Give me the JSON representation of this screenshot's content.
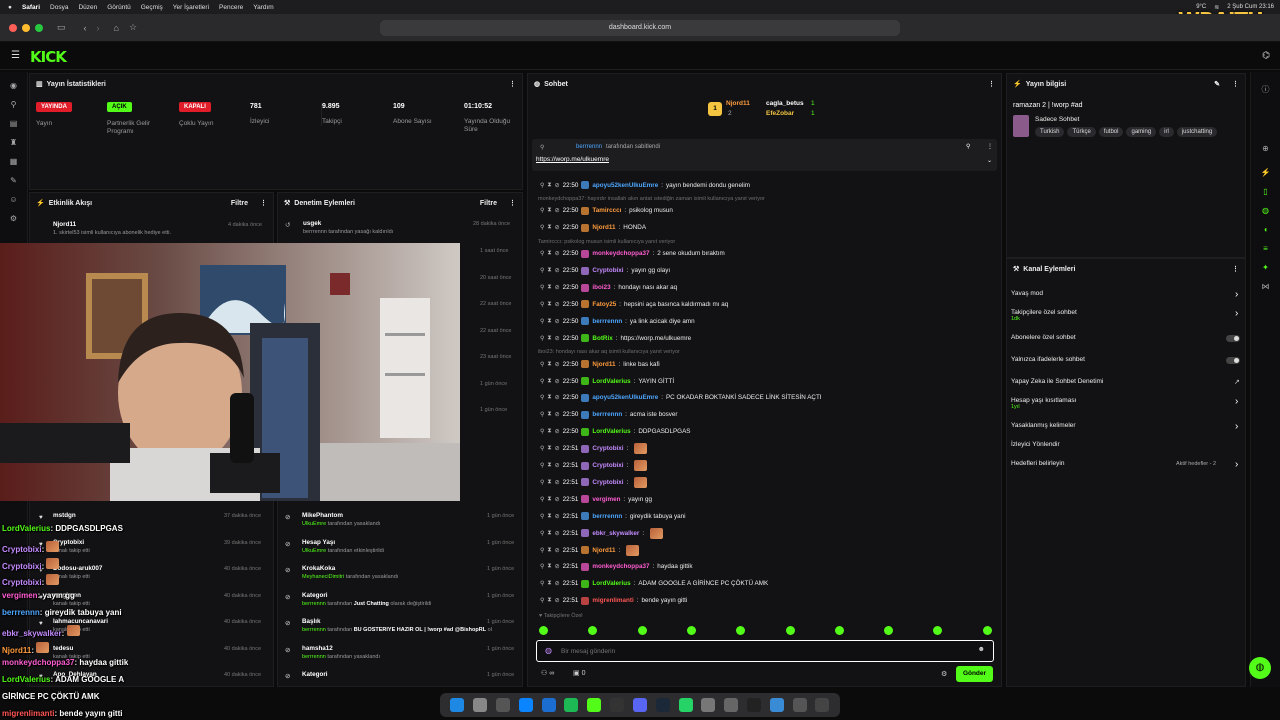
{
  "menubar": {
    "app": "Safari",
    "items": [
      "Dosya",
      "Düzen",
      "Görüntü",
      "Geçmiş",
      "Yer İşaretleri",
      "Pencere",
      "Yardım"
    ],
    "weather": "9°C",
    "clock": "2 Şub Cum 23:16"
  },
  "browser": {
    "url": "dashboard.kick.com"
  },
  "overlay_logo": "WRAITH",
  "brand": {
    "logo": "KICK",
    "accent": "#53fc18"
  },
  "stats": {
    "title": "Yayın İstatistikleri",
    "live_badge": "YAYINDA",
    "live_label": "Yayın",
    "partner_badge": "AÇIK",
    "partner_label": "Partnerlik Gelir Programı",
    "multi_badge": "KAPALI",
    "multi_label": "Çoklu Yayın",
    "viewers": "781",
    "viewers_label": "İzleyici",
    "followers": "9.895",
    "followers_label": "Takipçi",
    "subs": "109",
    "subs_label": "Abone Sayısı",
    "duration": "01:10:52",
    "duration_label": "Yayında Olduğu Süre"
  },
  "activity": {
    "title": "Etkinlik Akışı",
    "filter": "Filtre",
    "first": {
      "name": "Njord11",
      "desc": "1. skirtel53 isimli kullanıcıya abonelik hediye etti.",
      "time": "4 dakika önce"
    },
    "items": [
      {
        "name": "mstdgn",
        "desc": "",
        "time": "37 dakika önce"
      },
      {
        "name": "Cryptobixi",
        "desc": "kanalı takip etti",
        "time": "39 dakika önce"
      },
      {
        "name": "Dodosu-aruk007",
        "desc": "kanalı takip etti",
        "time": "40 dakika önce"
      },
      {
        "name": "vergimen",
        "desc": "kanalı takip etti",
        "time": "40 dakika önce"
      },
      {
        "name": "lahmacuncanavari",
        "desc": "kanalı takip etti",
        "time": "40 dakika önce"
      },
      {
        "name": "tedesu",
        "desc": "kanalı takip etti",
        "time": "40 dakika önce"
      },
      {
        "name": "Apo_Dehlayan",
        "desc": "",
        "time": "40 dakika önce"
      }
    ]
  },
  "moderation": {
    "title": "Denetim Eylemleri",
    "filter": "Filtre",
    "first": {
      "name": "usgek",
      "desc": "berrrennn tarafından yasağı kaldırıldı",
      "time": "28 dakika önce"
    },
    "times": [
      "1 saat önce",
      "20 saat önce",
      "22 saat önce",
      "22 saat önce",
      "23 saat önce",
      "1 gün önce",
      "1 gün önce"
    ],
    "items": [
      {
        "name": "MikePhantom",
        "actor": "UlkuEmre",
        "desc": "tarafından yasaklandı",
        "time": "1 gün önce"
      },
      {
        "name": "Hesap Yaşı",
        "actor": "UlkuEmre",
        "desc": "tarafından etkinleştirildi",
        "time": "1 gün önce"
      },
      {
        "name": "KrokaKoka",
        "actor": "MeyhaneciDimitri",
        "desc": "tarafından yasaklandı",
        "time": "1 gün önce"
      },
      {
        "name": "Kategori",
        "actor": "berrrennn",
        "desc": "tarafından",
        "extra": "Just Chatting",
        "desc2": "olarak değiştirildi",
        "time": "1 gün önce"
      },
      {
        "name": "Başlık",
        "actor": "berrrennn",
        "desc": "tarafından",
        "extra": "BU GÖSTERİYE HAZIR OL | !worp #ad @BishopRL",
        "desc2": "olarak değiştirildi",
        "time": "1 gün önce"
      },
      {
        "name": "hamsha12",
        "actor": "berrrennn",
        "desc": "tarafından yasaklandı",
        "time": "1 gün önce"
      },
      {
        "name": "Kategori",
        "actor": "",
        "desc": "",
        "time": "1 gün önce"
      }
    ]
  },
  "chat": {
    "title": "Sohbet",
    "leaders": [
      {
        "rank": "1",
        "name": "Njord11",
        "gift": "cagla_betus",
        "count": "1"
      },
      {
        "rank": "2",
        "name": "",
        "gift": "EfeZobar",
        "count": "1"
      }
    ],
    "pinned": {
      "by": "berrrennn",
      "label": "tarafından sabitlendi",
      "link": "https://worp.me/ulkuemre"
    },
    "messages": [
      {
        "time": "22:50",
        "user": "apoyu52kenUlkuEmre",
        "color": "#4ea7ff",
        "text": "yayın bendemi dondu genelim"
      },
      {
        "reply": "monkeydchoppa37: hayırdır insallah akın antat ıstediğin zaman isimli kullanıcıya yanıt veriyor"
      },
      {
        "time": "22:50",
        "user": "Tamircccı",
        "color": "#ff9c3d",
        "text": "psikolog musun"
      },
      {
        "time": "22:50",
        "user": "Njord11",
        "color": "#ff9c3d",
        "text": "HONDA"
      },
      {
        "reply": "Tamircccı: psikolog musun isimli kullanıcıya yanıt veriyor"
      },
      {
        "time": "22:50",
        "user": "monkeydchoppa37",
        "color": "#ff5ed2",
        "text": "2 sene okudum bıraktım"
      },
      {
        "time": "22:50",
        "user": "Cryptobixi",
        "color": "#c58bff",
        "text": "yayın gg olayı"
      },
      {
        "time": "22:50",
        "user": "iboi23",
        "color": "#ff5ed2",
        "text": "hondayı nası akar aq"
      },
      {
        "time": "22:50",
        "user": "Fatoy25",
        "color": "#ff9c3d",
        "text": "hepsini aça basınca kaldırmadı mı aq"
      },
      {
        "time": "22:50",
        "user": "berrrennn",
        "color": "#4ea7ff",
        "text": "ya link acicak diye amn"
      },
      {
        "time": "22:50",
        "user": "BotRix",
        "color": "#53fc18",
        "text": "https://worp.me/ulkuemre"
      },
      {
        "reply": "iboi23: hondayı nası akar aq isimli kullanıcıya yanıt veriyor"
      },
      {
        "time": "22:50",
        "user": "Njord11",
        "color": "#ff9c3d",
        "text": "linke bas kafi"
      },
      {
        "time": "22:50",
        "user": "LordValerius",
        "color": "#53fc18",
        "text": "YAYIN GİTTİ"
      },
      {
        "time": "22:50",
        "user": "apoyu52kenUlkuEmre",
        "color": "#4ea7ff",
        "text": "PC OKADAR BOKTANKİ SADECE LİNK SİTESİN AÇTI"
      },
      {
        "time": "22:50",
        "user": "berrrennn",
        "color": "#4ea7ff",
        "text": "acma iste bosver"
      },
      {
        "time": "22:50",
        "user": "LordValerius",
        "color": "#53fc18",
        "text": "DDPGASDLPGAS"
      },
      {
        "time": "22:51",
        "user": "Cryptobixi",
        "color": "#c58bff",
        "text": ""
      },
      {
        "time": "22:51",
        "user": "Cryptobixi",
        "color": "#c58bff",
        "text": ""
      },
      {
        "time": "22:51",
        "user": "Cryptobixi",
        "color": "#c58bff",
        "text": ""
      },
      {
        "time": "22:51",
        "user": "vergimen",
        "color": "#ff5ed2",
        "text": "yayın gg"
      },
      {
        "time": "22:51",
        "user": "berrrennn",
        "color": "#4ea7ff",
        "text": "gireydik tabuya yani"
      },
      {
        "time": "22:51",
        "user": "ebkr_skywalker",
        "color": "#c58bff",
        "text": ""
      },
      {
        "time": "22:51",
        "user": "Njord11",
        "color": "#ff9c3d",
        "text": ""
      },
      {
        "time": "22:51",
        "user": "monkeydchoppa37",
        "color": "#ff5ed2",
        "text": "haydaa gittik"
      },
      {
        "time": "22:51",
        "user": "LordValerius",
        "color": "#53fc18",
        "text": "ADAM GOOGLE A GİRİNCE PC ÇÖKTÜ AMK"
      },
      {
        "time": "22:51",
        "user": "migrenlimanti",
        "color": "#ff5555",
        "text": "bende yayın gitti"
      }
    ],
    "followers_only": "Takipçilere Özel",
    "input_placeholder": "Bir mesaj gönderin",
    "count": "0",
    "send": "Gönder"
  },
  "overlay_chat": [
    {
      "user": "LordValerius",
      "color": "#53fc18",
      "text": "DDPGASDLPGAS"
    },
    {
      "user": "Cryptobixi",
      "color": "#c58bff",
      "text": ""
    },
    {
      "user": "Cryptobixi",
      "color": "#c58bff",
      "text": ""
    },
    {
      "user": "Cryptobixi",
      "color": "#c58bff",
      "text": ""
    },
    {
      "user": "vergimen",
      "color": "#ff5ed2",
      "text": "yayın gg"
    },
    {
      "user": "berrrennn",
      "color": "#4ea7ff",
      "text": "gireydik tabuya yani"
    },
    {
      "user": "ebkr_skywalker",
      "color": "#c58bff",
      "text": ""
    },
    {
      "user": "Njord11",
      "color": "#ff9c3d",
      "text": ""
    },
    {
      "user": "monkeydchoppa37",
      "color": "#ff5ed2",
      "text": "haydaa gittik"
    },
    {
      "user": "LordValerius",
      "color": "#53fc18",
      "text": "ADAM GOOGLE A"
    },
    {
      "user": "",
      "color": "#fff",
      "text": "GİRİNCE PC ÇÖKTÜ AMK"
    },
    {
      "user": "migrenlimanti",
      "color": "#ff5555",
      "text": "bende yayın gitti"
    }
  ],
  "stream_info": {
    "title": "Yayın bilgisi",
    "stream_title": "ramazan 2 | !worp #ad",
    "category": "Sadece Sohbet",
    "tags": [
      "Turkish",
      "Türkçe",
      "futbol",
      "gaming",
      "irl",
      "justchatting"
    ]
  },
  "channel_actions": {
    "title": "Kanal Eylemleri",
    "items": [
      {
        "label": "Yavaş mod",
        "sub": "",
        "ctrl": "arrow"
      },
      {
        "label": "Takipçilere özel sohbet",
        "sub": "1dk",
        "ctrl": "arrow"
      },
      {
        "label": "Abonelere özel sohbet",
        "sub": "",
        "ctrl": "toggle"
      },
      {
        "label": "Yalnızca ifadelerle sohbet",
        "sub": "",
        "ctrl": "toggle"
      },
      {
        "label": "Yapay Zeka ile Sohbet Denetimi",
        "sub": "",
        "ctrl": "ext"
      },
      {
        "label": "Hesap yaşı kısıtlaması",
        "sub": "1yıl",
        "ctrl": "arrow"
      },
      {
        "label": "Yasaklanmış kelimeler",
        "sub": "",
        "ctrl": "arrow"
      },
      {
        "label": "İzleyici Yönlendir",
        "sub": "",
        "ctrl": ""
      },
      {
        "label": "Hedefleri belirleyin",
        "sub": "",
        "ctrl": "arrow",
        "extra": "Aktif hedefler - 2"
      }
    ]
  }
}
